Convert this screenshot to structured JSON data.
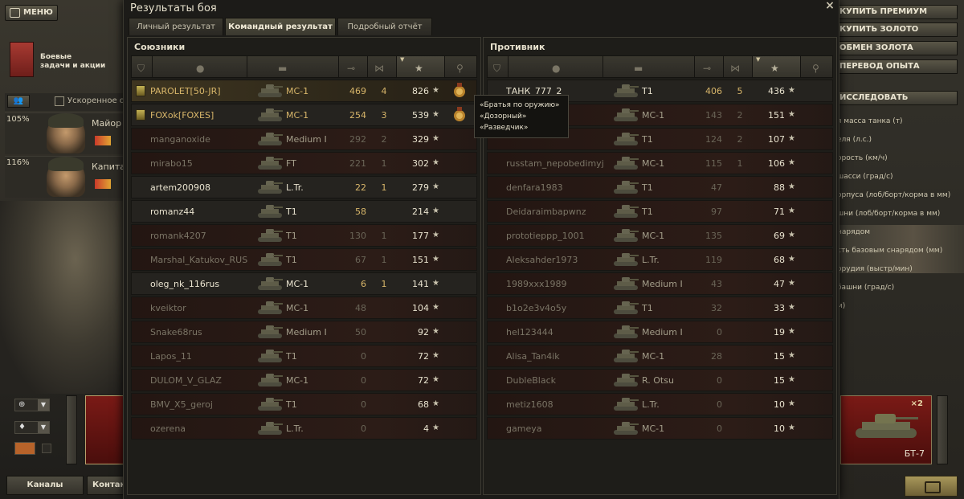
{
  "left_ui": {
    "menu_label": "МЕНЮ",
    "missions_line1": "Боевые",
    "missions_line2": "задачи и акции",
    "accelerated_label": "Ускоренное обучение",
    "crew": [
      {
        "pct": "105%",
        "rank": "Майор К"
      },
      {
        "pct": "116%",
        "rank": "Капитан"
      }
    ],
    "channels_label": "Каналы",
    "contacts_label": "Контакты"
  },
  "right_ui": {
    "buttons": [
      "КУПИТЬ ПРЕМИУМ",
      "КУПИТЬ ЗОЛОТО",
      "ОБМЕН ЗОЛОТА",
      "ПЕРЕВОД ОПЫТА"
    ],
    "research_label": "ИССЛЕДОВАТЬ",
    "params": [
      "я масса танка (т)",
      "еля (л.с.)",
      "орость (км/ч)",
      "шасси (град/с)",
      "орпуса (лоб/борт/корма в мм)",
      "шни (лоб/борт/корма в мм)",
      "нарядом",
      "сть базовым снарядом (мм)",
      "орудия (выстр/мин)",
      "башни (град/с)",
      "м)"
    ],
    "tank_name": "БТ-7",
    "x2_label": "×2"
  },
  "dialog": {
    "title": "Результаты боя",
    "tabs": [
      {
        "label": "Личный результат",
        "active": false
      },
      {
        "label": "Командный результат",
        "active": true
      },
      {
        "label": "Подробный отчёт",
        "active": false
      }
    ],
    "allies_title": "Союзники",
    "enemies_title": "Противник"
  },
  "allies": [
    {
      "name": "PAROLET[50-JR]",
      "vehicle": "MC-1",
      "damage": "469",
      "kills": "4",
      "xp": "826",
      "style": "hl",
      "color": "gold",
      "badge": true,
      "ach": true
    },
    {
      "name": "FOXok[FOXES]",
      "vehicle": "MC-1",
      "damage": "254",
      "kills": "3",
      "xp": "539",
      "style": "normal",
      "color": "gold",
      "badge": true,
      "ach": true
    },
    {
      "name": "manganoxide",
      "vehicle": "Medium I",
      "damage": "292",
      "kills": "2",
      "xp": "329",
      "style": "dark",
      "color": "gray"
    },
    {
      "name": "mirabo15",
      "vehicle": "FT",
      "damage": "221",
      "kills": "1",
      "xp": "302",
      "style": "dark",
      "color": "gray"
    },
    {
      "name": "artem200908",
      "vehicle": "L.Tr.",
      "damage": "22",
      "kills": "1",
      "xp": "279",
      "style": "normal",
      "color": "white"
    },
    {
      "name": "romanz44",
      "vehicle": "T1",
      "damage": "58",
      "kills": "",
      "xp": "214",
      "style": "normal",
      "color": "white"
    },
    {
      "name": "romank4207",
      "vehicle": "T1",
      "damage": "130",
      "kills": "1",
      "xp": "177",
      "style": "dark",
      "color": "gray"
    },
    {
      "name": "Marshal_Katukov_RUS",
      "vehicle": "T1",
      "damage": "67",
      "kills": "1",
      "xp": "151",
      "style": "dark",
      "color": "gray"
    },
    {
      "name": "oleg_nk_116rus",
      "vehicle": "MC-1",
      "damage": "6",
      "kills": "1",
      "xp": "141",
      "style": "normal",
      "color": "white"
    },
    {
      "name": "kveiktor",
      "vehicle": "MC-1",
      "damage": "48",
      "kills": "",
      "xp": "104",
      "style": "dark",
      "color": "gray"
    },
    {
      "name": "Snake68rus",
      "vehicle": "Medium I",
      "damage": "50",
      "kills": "",
      "xp": "92",
      "style": "dark",
      "color": "gray"
    },
    {
      "name": "Lapos_11",
      "vehicle": "T1",
      "damage": "0",
      "kills": "",
      "xp": "72",
      "style": "dark",
      "color": "gray"
    },
    {
      "name": "DULOM_V_GLAZ",
      "vehicle": "MC-1",
      "damage": "0",
      "kills": "",
      "xp": "72",
      "style": "dark",
      "color": "gray"
    },
    {
      "name": "BMV_X5_geroj",
      "vehicle": "T1",
      "damage": "0",
      "kills": "",
      "xp": "68",
      "style": "dark",
      "color": "gray"
    },
    {
      "name": "ozerena",
      "vehicle": "L.Tr.",
      "damage": "0",
      "kills": "",
      "xp": "4",
      "style": "dark",
      "color": "gray"
    }
  ],
  "enemies": [
    {
      "name": "ТАНК_777_2",
      "vehicle": "T1",
      "damage": "406",
      "kills": "5",
      "xp": "436",
      "style": "normal",
      "color": "white"
    },
    {
      "name": "",
      "vehicle": "MC-1",
      "damage": "143",
      "kills": "2",
      "xp": "151",
      "style": "dark",
      "color": "gray"
    },
    {
      "name": "",
      "vehicle": "T1",
      "damage": "124",
      "kills": "2",
      "xp": "107",
      "style": "dark",
      "color": "gray"
    },
    {
      "name": "russtam_nepobedimyj",
      "vehicle": "MC-1",
      "damage": "115",
      "kills": "1",
      "xp": "106",
      "style": "dark",
      "color": "gray"
    },
    {
      "name": "denfara1983",
      "vehicle": "T1",
      "damage": "47",
      "kills": "",
      "xp": "88",
      "style": "dark",
      "color": "gray"
    },
    {
      "name": "Deidaraimbapwnz",
      "vehicle": "T1",
      "damage": "97",
      "kills": "",
      "xp": "71",
      "style": "dark",
      "color": "gray"
    },
    {
      "name": "prototieppp_1001",
      "vehicle": "MC-1",
      "damage": "135",
      "kills": "",
      "xp": "69",
      "style": "dark",
      "color": "gray"
    },
    {
      "name": "Aleksahder1973",
      "vehicle": "L.Tr.",
      "damage": "119",
      "kills": "",
      "xp": "68",
      "style": "dark",
      "color": "gray"
    },
    {
      "name": "1989xxx1989",
      "vehicle": "Medium I",
      "damage": "43",
      "kills": "",
      "xp": "47",
      "style": "dark",
      "color": "gray"
    },
    {
      "name": "b1o2e3v4o5y",
      "vehicle": "T1",
      "damage": "32",
      "kills": "",
      "xp": "33",
      "style": "dark",
      "color": "gray"
    },
    {
      "name": "hel123444",
      "vehicle": "Medium I",
      "damage": "0",
      "kills": "",
      "xp": "19",
      "style": "dark",
      "color": "gray"
    },
    {
      "name": "Alisa_Tan4ik",
      "vehicle": "MC-1",
      "damage": "28",
      "kills": "",
      "xp": "15",
      "style": "dark",
      "color": "gray"
    },
    {
      "name": "DubleBlack",
      "vehicle": "R. Otsu",
      "damage": "0",
      "kills": "",
      "xp": "15",
      "style": "dark",
      "color": "gray"
    },
    {
      "name": "metiz1608",
      "vehicle": "L.Tr.",
      "damage": "0",
      "kills": "",
      "xp": "10",
      "style": "dark",
      "color": "gray"
    },
    {
      "name": "gameya",
      "vehicle": "MC-1",
      "damage": "0",
      "kills": "",
      "xp": "10",
      "style": "dark",
      "color": "gray"
    }
  ],
  "tooltip": {
    "lines": [
      "«Братья по оружию»",
      "«Дозорный»",
      "«Разведчик»"
    ]
  }
}
